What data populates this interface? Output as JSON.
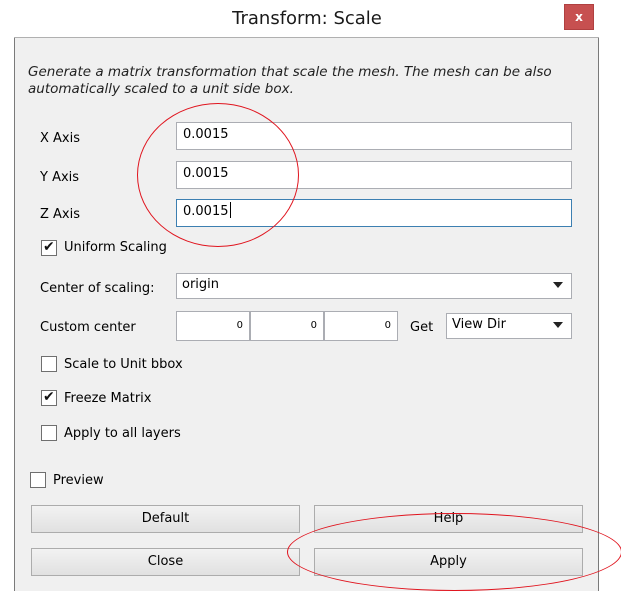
{
  "window": {
    "title": "Transform: Scale",
    "close_glyph": "x"
  },
  "description": "Generate a matrix transformation that scale the mesh. The mesh can be also automatically scaled to a unit side box.",
  "fields": [
    {
      "label": "X Axis",
      "value": "0.0015"
    },
    {
      "label": "Y Axis",
      "value": "0.0015"
    },
    {
      "label": "Z Axis",
      "value": "0.0015"
    }
  ],
  "uniform_scaling": {
    "label": "Uniform Scaling",
    "checked": true
  },
  "center_of_scaling": {
    "label": "Center of scaling:",
    "selected": "origin"
  },
  "custom_center": {
    "label": "Custom center",
    "values": [
      "0",
      "0",
      "0"
    ],
    "get_label": "Get",
    "dir_selected": "View Dir"
  },
  "options": [
    {
      "label": "Scale to Unit bbox",
      "checked": false
    },
    {
      "label": "Freeze Matrix",
      "checked": true
    },
    {
      "label": "Apply to all layers",
      "checked": false
    }
  ],
  "preview": {
    "label": "Preview",
    "checked": false
  },
  "buttons": {
    "default": "Default",
    "help": "Help",
    "close": "Close",
    "apply": "Apply"
  },
  "annotation_color": "#e0141e",
  "icons": {
    "close": "close-icon",
    "dropdown": "chevron-down-icon",
    "check": "checkmark-icon"
  }
}
